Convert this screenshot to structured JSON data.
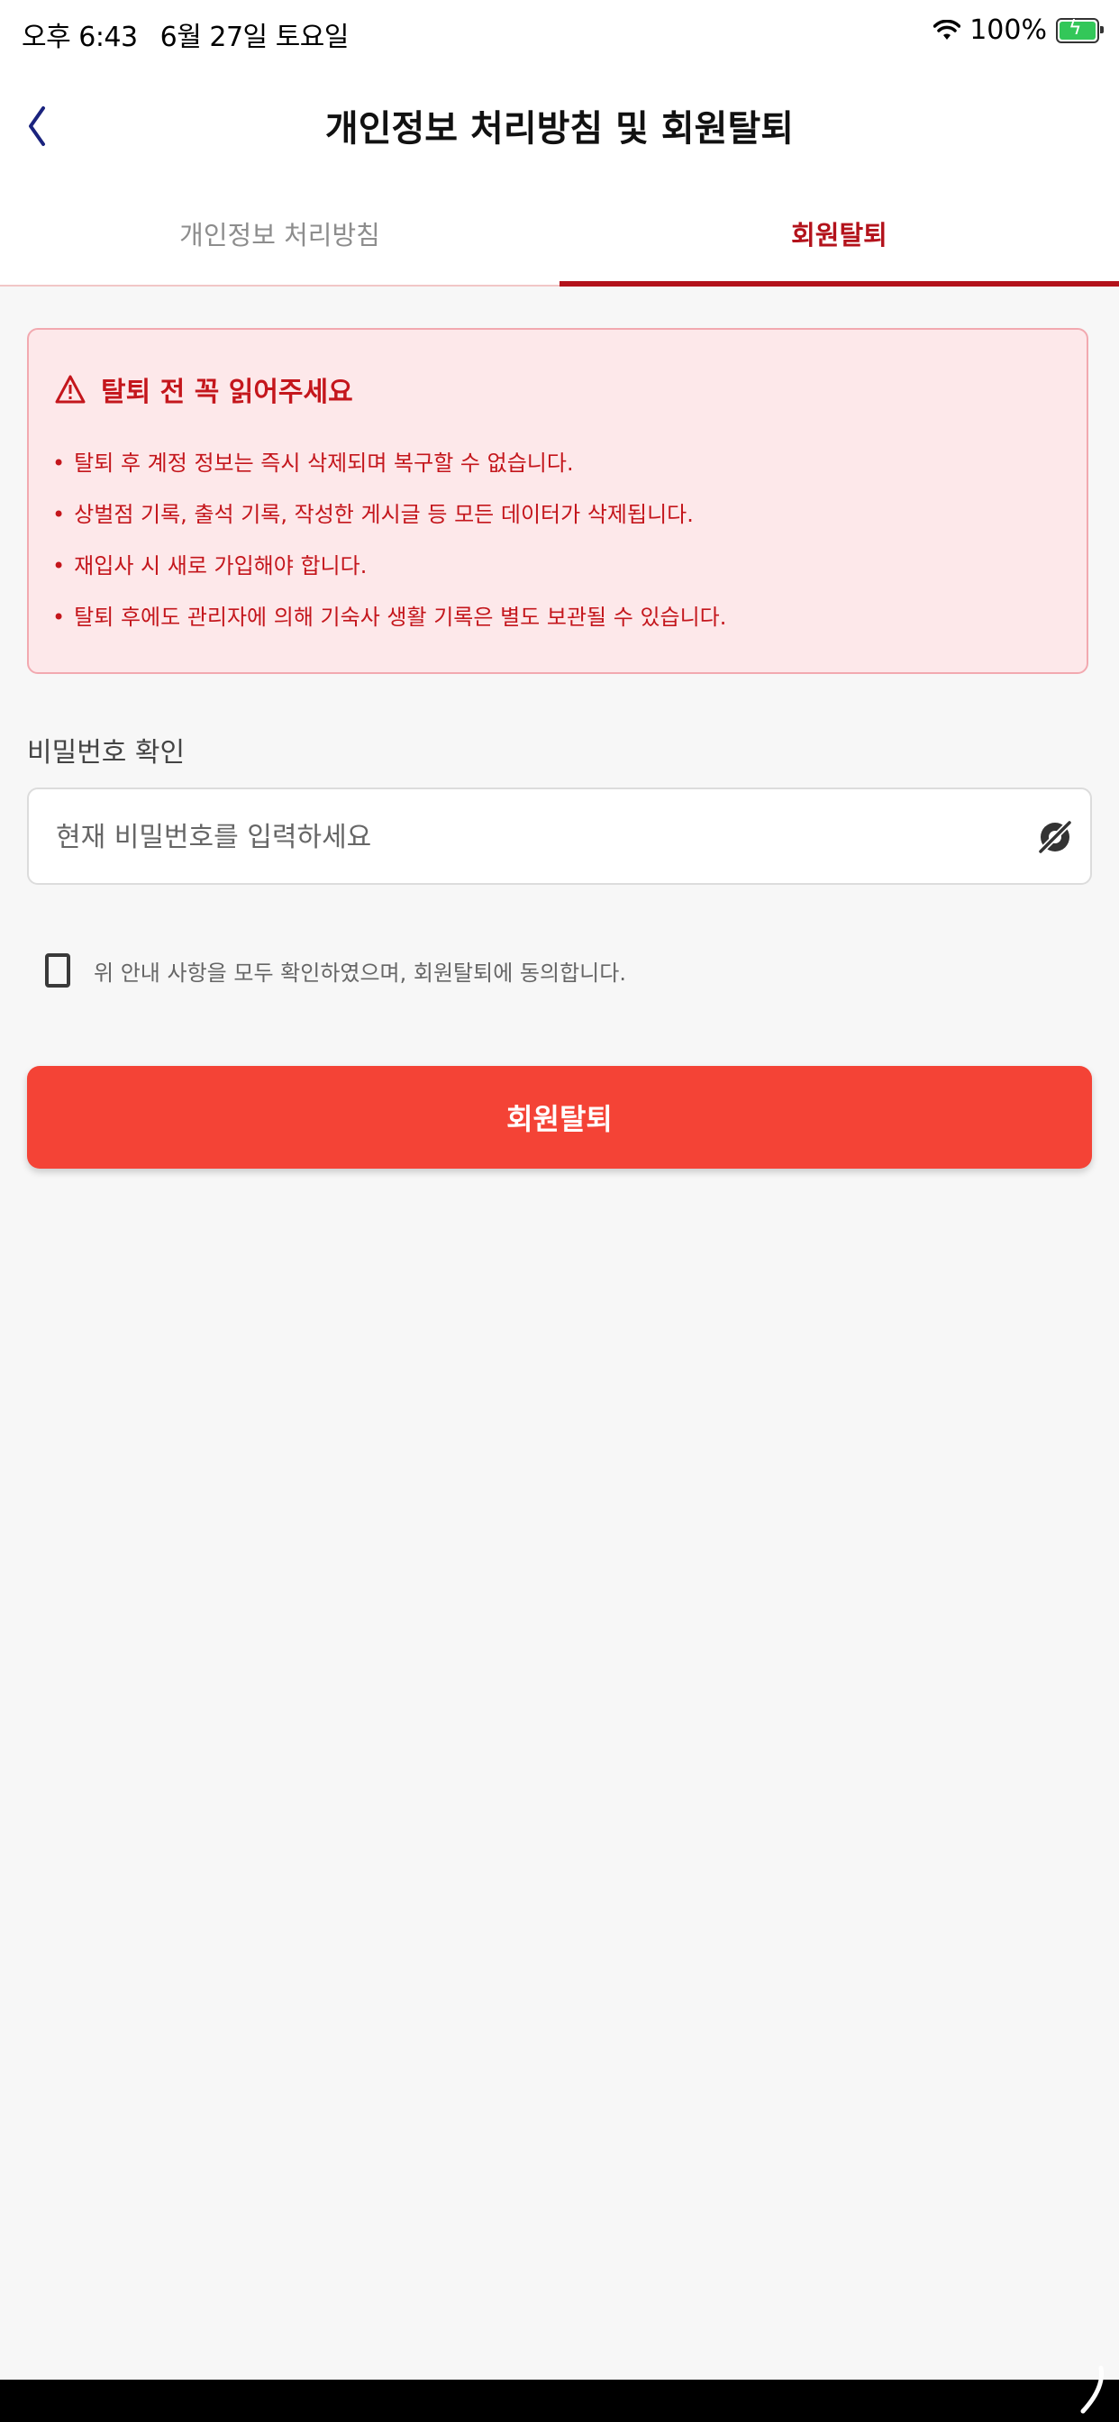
{
  "status_bar": {
    "time": "오후 6:43",
    "date": "6월 27일 토요일",
    "battery": "100%"
  },
  "header": {
    "title": "개인정보 처리방침 및 회원탈퇴",
    "back_icon": "chevron-left-icon"
  },
  "tabs": [
    {
      "label": "개인정보 처리방침",
      "active": false
    },
    {
      "label": "회원탈퇴",
      "active": true
    }
  ],
  "warning": {
    "title": "탈퇴 전 꼭 읽어주세요",
    "items": [
      "탈퇴 후 계정 정보는 즉시 삭제되며 복구할 수 없습니다.",
      "상벌점 기록, 출석 기록, 작성한 게시글 등 모든 데이터가 삭제됩니다.",
      "재입사 시 새로 가입해야 합니다.",
      "탈퇴 후에도 관리자에 의해 기숙사 생활 기록은 별도 보관될 수 있습니다."
    ]
  },
  "password": {
    "label": "비밀번호 확인",
    "placeholder": "현재 비밀번호를 입력하세요",
    "value": ""
  },
  "agreement": {
    "label": "위 안내 사항을 모두 확인하였으며, 회원탈퇴에 동의합니다.",
    "checked": false
  },
  "submit": {
    "label": "회원탈퇴"
  },
  "colors": {
    "accent": "#b3121b",
    "button": "#f44336",
    "warning_bg": "#fde8ea",
    "warning_text": "#c4161c"
  }
}
